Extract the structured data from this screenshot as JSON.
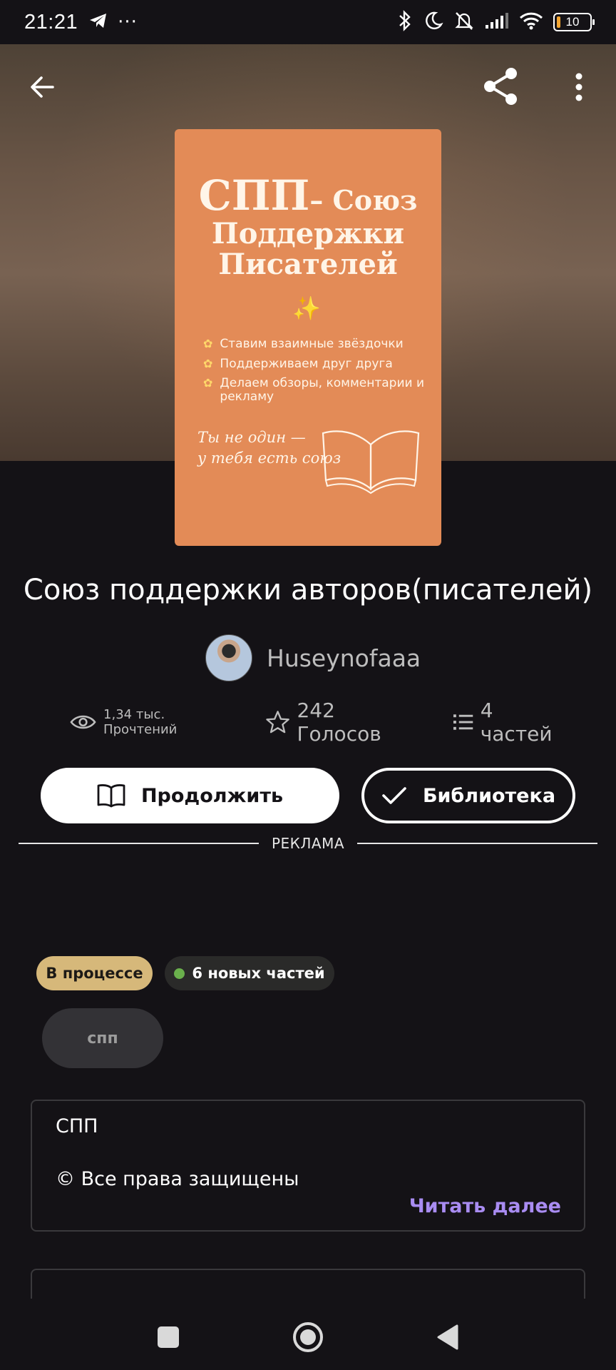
{
  "status_bar": {
    "time": "21:21",
    "overflow": "···",
    "battery": "10",
    "icons": [
      "telegram-icon",
      "bluetooth-icon",
      "moon-icon",
      "mute-icon",
      "signal-icon",
      "wifi-icon",
      "battery-icon"
    ]
  },
  "header": {
    "back_icon": "arrow-left-icon",
    "share_icon": "share-icon",
    "more_icon": "more-vertical-icon"
  },
  "cover": {
    "title_big": "СПП",
    "title_dash": "– Союз",
    "title_line2": "Поддержки",
    "title_line3": "Писателей",
    "sparkle": "✨",
    "bullets": [
      "Ставим взаимные звёздочки",
      "Поддерживаем друг друга",
      "Делаем обзоры, комментарии и рекламу"
    ],
    "motto_line1": "Ты не один —",
    "motto_line2": "у тебя есть союз",
    "bg_color": "#e38b57"
  },
  "book": {
    "title": "Союз поддержки авторов(писателей)",
    "author": "Huseynofaaa",
    "reads": "1,34 тыс. Прочтений",
    "votes": "242 Голосов",
    "parts": "4 частей"
  },
  "actions": {
    "continue_label": "Продолжить",
    "library_label": "Библиотека"
  },
  "ad": {
    "label": "РЕКЛАМА"
  },
  "badges": {
    "status": "В процессе",
    "new_parts": "6 новых частей",
    "tag": "спп"
  },
  "description": {
    "line1": "СПП",
    "line2": "© Все права защищены",
    "read_more": "Читать далее"
  },
  "colors": {
    "background": "#141216",
    "status_badge": "#d6b87a",
    "new_dot": "#6ab04c",
    "read_more": "#a98cf2"
  }
}
